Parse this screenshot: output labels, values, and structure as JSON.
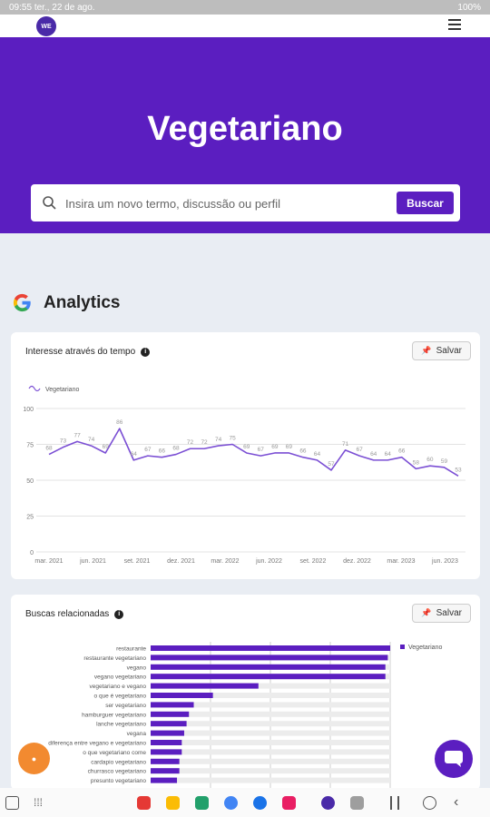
{
  "status_bar": {
    "time": "09:55",
    "date": "ter., 22 de ago.",
    "battery": "100%"
  },
  "brand": {
    "logo_text": "WE"
  },
  "hero": {
    "title": "Vegetariano"
  },
  "search": {
    "placeholder": "Insira um novo termo, discussão ou perfil",
    "button": "Buscar"
  },
  "analytics": {
    "title": "Analytics"
  },
  "interest_card": {
    "title": "Interesse através do tempo",
    "save": "Salvar"
  },
  "related_card": {
    "title": "Buscas relacionadas",
    "save": "Salvar"
  },
  "colors": {
    "accent": "#5b1ec0",
    "line": "#7b4fd4"
  },
  "chart_data": [
    {
      "type": "line",
      "legend": [
        "Vegetariano"
      ],
      "ylim": [
        0,
        100
      ],
      "yticks": [
        0,
        25,
        50,
        75,
        100
      ],
      "xticklabels": [
        "mar. 2021",
        "jun. 2021",
        "set. 2021",
        "dez. 2021",
        "mar. 2022",
        "jun. 2022",
        "set. 2022",
        "dez. 2022",
        "mar. 2023",
        "jun. 2023"
      ],
      "series": [
        {
          "name": "Vegetariano",
          "values": [
            68,
            73,
            77,
            74,
            69,
            86,
            64,
            67,
            66,
            68,
            72,
            72,
            74,
            75,
            69,
            67,
            69,
            69,
            66,
            64,
            57,
            71,
            67,
            64,
            64,
            66,
            58,
            60,
            59,
            53
          ]
        }
      ],
      "grid": true,
      "legend_position": "top-left"
    },
    {
      "type": "bar",
      "orientation": "horizontal",
      "legend": [
        "Vegetariano"
      ],
      "categories": [
        "restaurante",
        "restaurante vegetariano",
        "vegano",
        "vegano vegetariano",
        "vegetariano e vegano",
        "o que é vegetariano",
        "ser vegetariano",
        "hamburguer vegetariano",
        "lanche vegetariano",
        "vegana",
        "diferença entre vegano e vegetariano",
        "o que vegetariano come",
        "cardapio vegetariano",
        "churrasco vegetariano",
        "presunto vegetariano"
      ],
      "values": [
        100,
        99,
        98,
        98,
        45,
        26,
        18,
        16,
        15,
        14,
        13,
        13,
        12,
        12,
        11
      ],
      "xlim": [
        0,
        100
      ],
      "legend_position": "right"
    }
  ]
}
